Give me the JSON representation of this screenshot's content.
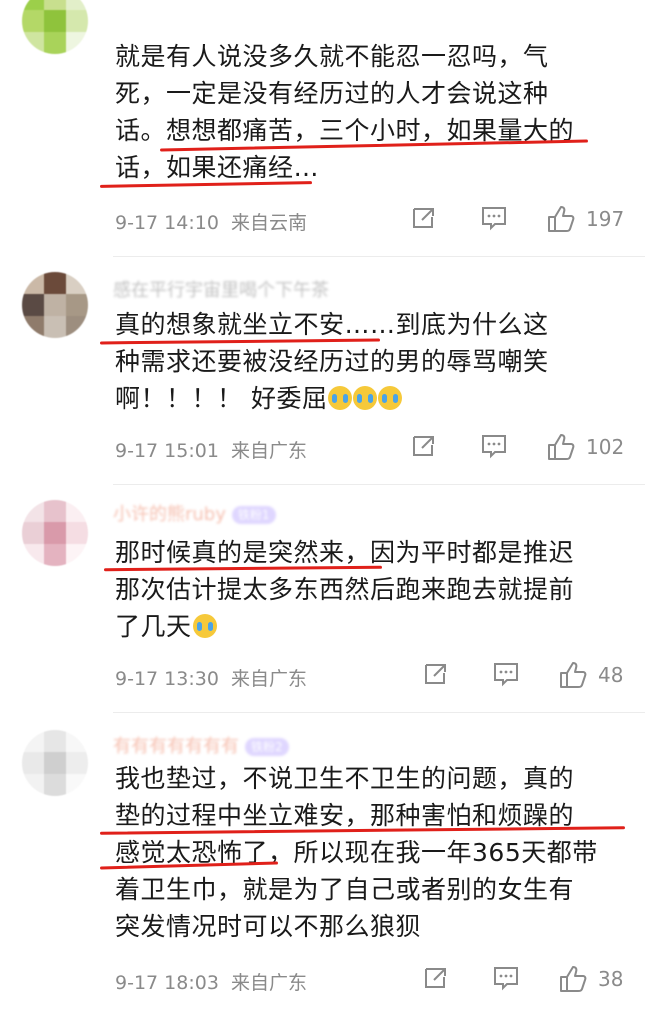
{
  "comments": [
    {
      "username": "",
      "text": "就是有人说没多久就不能忍一忍吗，气死，一定是没有经历过的人才会说这种话。想想都痛苦，三个小时，如果量大的话，如果还痛经…",
      "lines": [
        "就是有人说没多久就不能忍一忍吗，气",
        "死，一定是没有经历过的人才会说这种",
        "话。想想都痛苦，三个小时，如果量大的",
        "话，如果还痛经…"
      ],
      "time": "9-17 14:10",
      "source": "来自云南",
      "likes": "197"
    },
    {
      "username": "感在平行宇宙里喝个下午茶",
      "text": "真的想象就坐立不安……到底为什么这种需求还要被没经历过的男的辱骂嘲笑啊！！！！好委屈",
      "lines": [
        "真的想象就坐立不安……到底为什么这",
        "种需求还要被没经历过的男的辱骂嘲笑",
        "啊！！！！ 好委屈"
      ],
      "time": "9-17 15:01",
      "source": "来自广东",
      "likes": "102"
    },
    {
      "username": "小许的熊ruby",
      "badge": "铁粉1",
      "text": "那时候真的是突然来，因为平时都是推迟那次估计提太多东西然后跑来跑去就提前了几天",
      "lines": [
        "那时候真的是突然来，因为平时都是推迟",
        "那次估计提太多东西然后跑来跑去就提前",
        "了几天"
      ],
      "time": "9-17 13:30",
      "source": "来自广东",
      "likes": "48"
    },
    {
      "username": "有有有有有有有",
      "badge": "铁粉2",
      "text": "我也垫过，不说卫生不卫生的问题，真的垫的过程中坐立难安，那种害怕和烦躁的感觉太恐怖了，所以现在我一年365天都带着卫生巾，就是为了自己或者别的女生有突发情况时可以不那么狼狈",
      "lines": [
        "我也垫过，不说卫生不卫生的问题，真的",
        "垫的过程中坐立难安，那种害怕和烦躁的",
        "感觉太恐怖了，所以现在我一年365天都带",
        "着卫生巾，就是为了自己或者别的女生有",
        "突发情况时可以不那么狼狈"
      ],
      "time": "9-17 18:03",
      "source": "来自广东",
      "likes": "38"
    }
  ],
  "icons": {
    "repost": "share-icon",
    "comment": "comment-icon",
    "like": "thumbs-up-icon"
  },
  "colors": {
    "highlight_line": "#e0201a",
    "meta_text": "#8a8a8a",
    "username": "#eb7350"
  }
}
